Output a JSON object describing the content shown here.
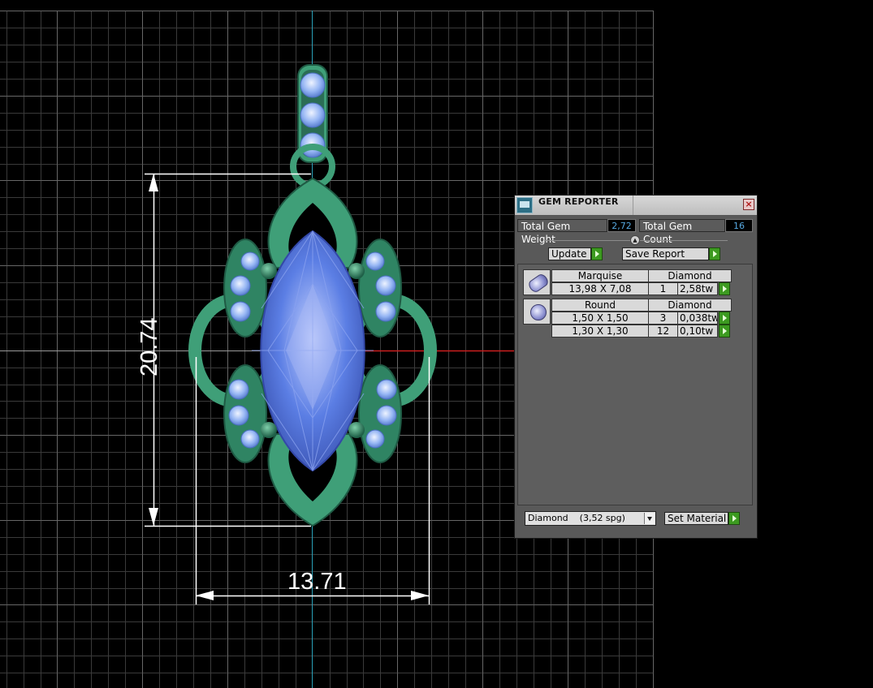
{
  "dimensions": {
    "height_label": "20.74",
    "width_label": "13.71"
  },
  "gem_reporter": {
    "title": "GEM REPORTER",
    "total_gem_weight_label": "Total Gem Weight",
    "total_gem_weight": "2,72",
    "total_gem_count_label": "Total Gem Count",
    "total_gem_count": "16",
    "update_label": "Update",
    "save_report_label": "Save Report",
    "groups": [
      {
        "shape": "Marquise",
        "material": "Diamond",
        "rows": [
          {
            "size": "13,98 X 7,08",
            "count": "1",
            "weight": "2,58tw"
          }
        ]
      },
      {
        "shape": "Round",
        "material": "Diamond",
        "rows": [
          {
            "size": "1,50 X 1,50",
            "count": "3",
            "weight": "0,038tw"
          },
          {
            "size": "1,30 X 1,30",
            "count": "12",
            "weight": "0,10tw"
          }
        ]
      }
    ],
    "material_select": "Diamond    (3,52 spg)",
    "set_material_label": "Set Material"
  },
  "colors": {
    "background": "#000000",
    "grid": "#8a8a8a",
    "metal": "#3f9f78",
    "center_stone": "#4d6fd8",
    "accent_stones": "#8fb2f0",
    "axis_x": "#cc1e1e",
    "axis_y": "#2aa0b8"
  }
}
